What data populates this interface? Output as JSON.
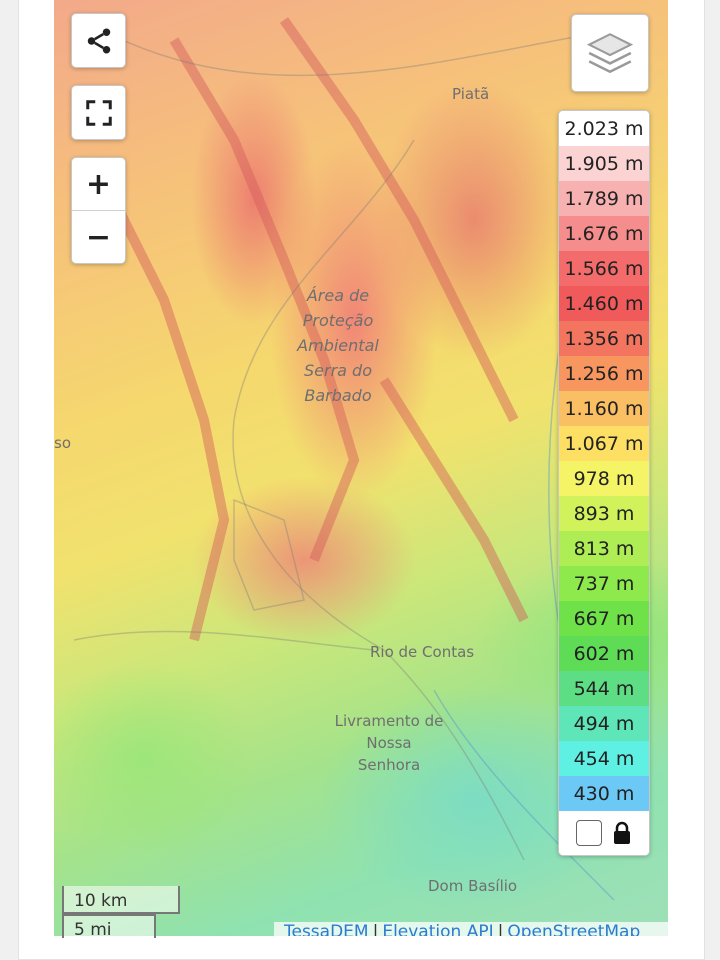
{
  "map": {
    "places": [
      {
        "name": "Piatã"
      },
      {
        "name": "Rio de Contas"
      },
      {
        "name": "Livramento de Nossa Senhora"
      },
      {
        "name": "Dom Basílio"
      },
      {
        "name": "so"
      }
    ],
    "protected_area": "Área de Proteção Ambiental Serra do Barbado"
  },
  "controls": {
    "share_icon": "share-icon",
    "fullscreen_icon": "fullscreen-icon",
    "zoom_in": "+",
    "zoom_out": "−",
    "layers_icon": "layers-icon"
  },
  "legend": {
    "entries": [
      {
        "label": "2.023 m",
        "color": "#ffffff"
      },
      {
        "label": "1.905 m",
        "color": "#fbd3d3"
      },
      {
        "label": "1.789 m",
        "color": "#f8b1b1"
      },
      {
        "label": "1.676 m",
        "color": "#f58d8d"
      },
      {
        "label": "1.566 m",
        "color": "#f36b6b"
      },
      {
        "label": "1.460 m",
        "color": "#f05a5a"
      },
      {
        "label": "1.356 m",
        "color": "#f37560"
      },
      {
        "label": "1.256 m",
        "color": "#f89660"
      },
      {
        "label": "1.160 m",
        "color": "#fbbf63"
      },
      {
        "label": "1.067 m",
        "color": "#fde063"
      },
      {
        "label": "978 m",
        "color": "#f4f466"
      },
      {
        "label": "893 m",
        "color": "#d2f25c"
      },
      {
        "label": "813 m",
        "color": "#aeed54"
      },
      {
        "label": "737 m",
        "color": "#8de94c"
      },
      {
        "label": "667 m",
        "color": "#6fe24a"
      },
      {
        "label": "602 m",
        "color": "#5fdc55"
      },
      {
        "label": "544 m",
        "color": "#5ede84"
      },
      {
        "label": "494 m",
        "color": "#5fe6b8"
      },
      {
        "label": "454 m",
        "color": "#5ff0e4"
      },
      {
        "label": "430 m",
        "color": "#6cc8f4"
      }
    ],
    "lock_icon": "lock-icon"
  },
  "scale": {
    "km": "10 km",
    "mi": "5 mi"
  },
  "attribution": {
    "items": [
      "TessaDEM",
      "Elevation API",
      "OpenStreetMap"
    ],
    "separator": "|"
  }
}
